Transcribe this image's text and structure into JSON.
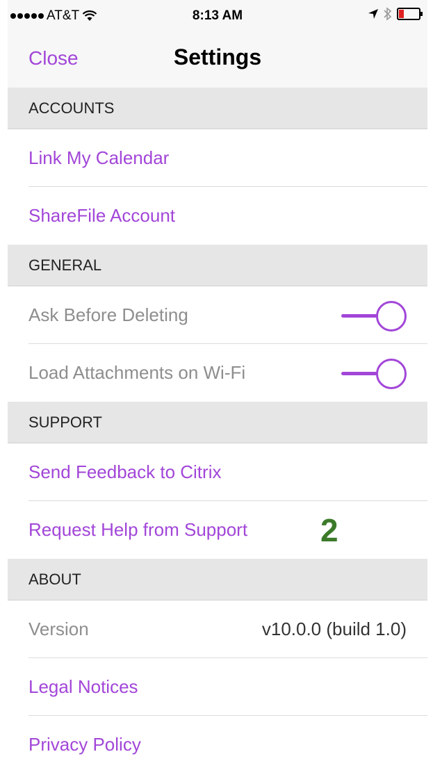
{
  "status_bar": {
    "carrier": "AT&T",
    "time": "8:13 AM"
  },
  "nav": {
    "close_label": "Close",
    "title": "Settings"
  },
  "sections": {
    "accounts": {
      "header": "ACCOUNTS",
      "link_calendar": "Link My Calendar",
      "sharefile": "ShareFile Account"
    },
    "general": {
      "header": "GENERAL",
      "ask_before_deleting": "Ask Before Deleting",
      "load_attachments": "Load Attachments on Wi-Fi"
    },
    "support": {
      "header": "SUPPORT",
      "send_feedback": "Send Feedback to Citrix",
      "request_help": "Request Help from Support"
    },
    "about": {
      "header": "ABOUT",
      "version_label": "Version",
      "version_value": "v10.0.0 (build 1.0)",
      "legal": "Legal Notices",
      "privacy": "Privacy Policy"
    }
  },
  "annotation": "2",
  "colors": {
    "accent": "#a246d8",
    "annotation": "#3c7a2a",
    "section_bg": "#e6e6e6"
  },
  "icons": [
    "signal-dots-icon",
    "wifi-icon",
    "location-arrow-icon",
    "bluetooth-icon",
    "battery-icon"
  ],
  "toggles": {
    "ask_before_deleting": true,
    "load_attachments": true
  },
  "battery_level": 0.25
}
